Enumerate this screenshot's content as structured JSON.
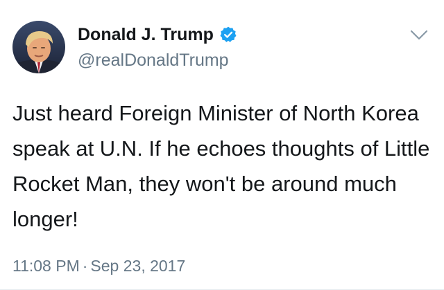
{
  "user": {
    "display_name": "Donald J. Trump",
    "handle": "@realDonaldTrump",
    "verified": true
  },
  "tweet": {
    "text": "Just heard Foreign Minister of North Korea speak at U.N. If he echoes thoughts of Little Rocket Man, they won't be around much longer!",
    "time": "11:08 PM",
    "separator": "·",
    "date": "Sep 23, 2017"
  },
  "icons": {
    "verified": "verified-badge-icon",
    "menu": "chevron-down-icon"
  },
  "colors": {
    "verified_blue": "#1da1f2",
    "secondary_text": "#657786",
    "primary_text": "#14171a"
  }
}
